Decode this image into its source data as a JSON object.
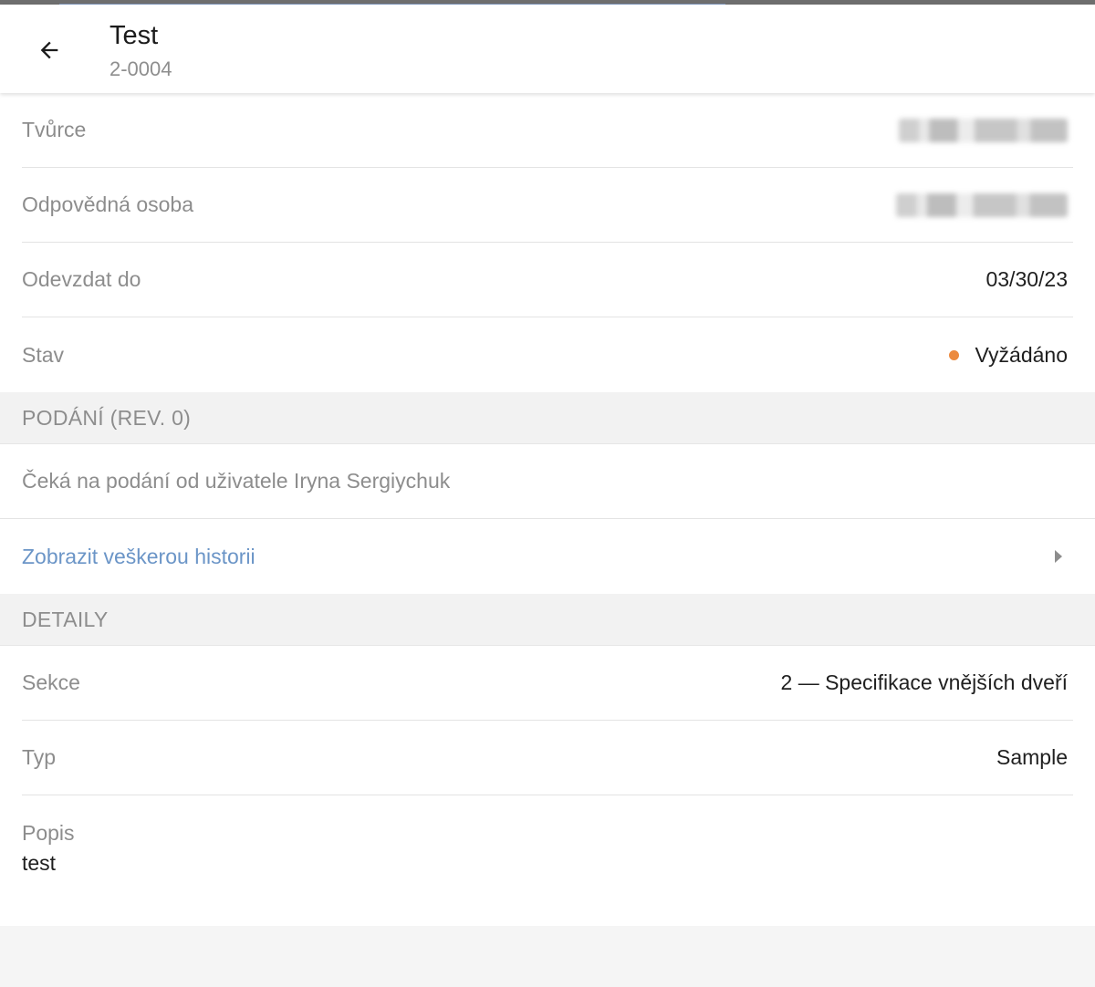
{
  "header": {
    "title": "Test",
    "subtitle": "2-0004",
    "back_icon": "arrow-left-icon"
  },
  "fields": {
    "creator": {
      "label": "Tvůrce",
      "value": ""
    },
    "responsible": {
      "label": "Odpovědná osoba",
      "value": ""
    },
    "due_date": {
      "label": "Odevzdat do",
      "value": "03/30/23"
    },
    "status": {
      "label": "Stav",
      "value": "Vyžádáno",
      "color": "#ec8a3e"
    }
  },
  "submission": {
    "header": "PODÁNÍ (REV. 0)",
    "waiting_text": "Čeká na podání od uživatele Iryna Sergiychuk",
    "history_link": "Zobrazit veškerou historii"
  },
  "details": {
    "header": "DETAILY",
    "section": {
      "label": "Sekce",
      "value": "2 — Specifikace vnějších dveří"
    },
    "type": {
      "label": "Typ",
      "value": "Sample"
    },
    "description": {
      "label": "Popis",
      "value": "test"
    }
  },
  "colors": {
    "link": "#6b95c7",
    "progress": "#7b92b6"
  }
}
